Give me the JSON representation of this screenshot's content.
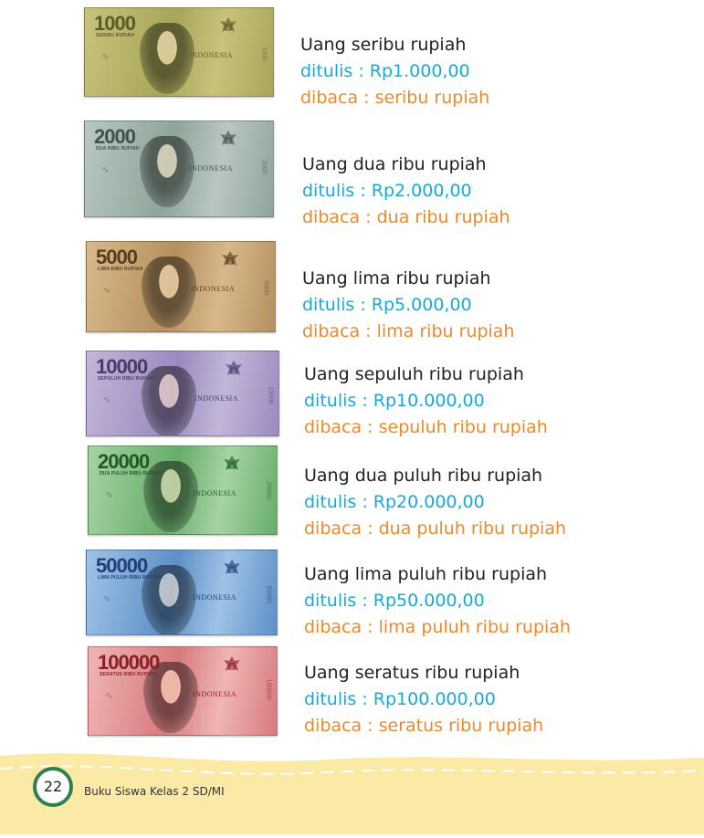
{
  "notes": [
    {
      "denom": "1000",
      "words": "SERIBU RUPIAH",
      "country": "INDONESIA",
      "title": "Uang seribu rupiah",
      "ditulis": "ditulis  : Rp1.000,00",
      "dibaca": "dibaca : seribu rupiah",
      "color_a": "#c8c27a",
      "color_b": "#a8a65a",
      "ink": "#5b5a2a"
    },
    {
      "denom": "2000",
      "words": "DUA RIBU RUPIAH",
      "country": "INDONESIA",
      "title": "Uang dua ribu rupiah",
      "ditulis": "ditulis  : Rp2.000,00",
      "dibaca": "dibaca : dua ribu rupiah",
      "color_a": "#b9c7c0",
      "color_b": "#8fa59a",
      "ink": "#3e5249"
    },
    {
      "denom": "5000",
      "words": "LIMA RIBU RUPIAH",
      "country": "INDONESIA",
      "title": "Uang lima ribu rupiah",
      "ditulis": "ditulis  : Rp5.000,00",
      "dibaca": "dibaca : lima ribu rupiah",
      "color_a": "#d8b98c",
      "color_b": "#b58f5e",
      "ink": "#5a3b1e"
    },
    {
      "denom": "10000",
      "words": "SEPULUH RIBU RUPIAH",
      "country": "INDONESIA",
      "title": "Uang sepuluh ribu rupiah",
      "ditulis": "ditulis  : Rp10.000,00",
      "dibaca": "dibaca : sepuluh ribu rupiah",
      "color_a": "#c2b6d8",
      "color_b": "#9c89bf",
      "ink": "#4a3a6a"
    },
    {
      "denom": "20000",
      "words": "DUA PULUH RIBU RUPIAH",
      "country": "INDONESIA",
      "title": "Uang dua puluh ribu rupiah",
      "ditulis": "ditulis  : Rp20.000,00",
      "dibaca": "dibaca : dua puluh ribu rupiah",
      "color_a": "#a6d3a4",
      "color_b": "#67ad6a",
      "ink": "#1f5a26"
    },
    {
      "denom": "50000",
      "words": "LIMA PULUH RIBU RUPIAH",
      "country": "INDONESIA",
      "title": "Uang lima puluh ribu rupiah",
      "ditulis": "ditulis  : Rp50.000,00",
      "dibaca": "dibaca : lima puluh ribu rupiah",
      "color_a": "#9fc3e6",
      "color_b": "#5d8fc7",
      "ink": "#1e3f78"
    },
    {
      "denom": "100000",
      "words": "SERATUS RIBU RUPIAH",
      "country": "INDONESIA",
      "title": "Uang seratus ribu rupiah",
      "ditulis": "ditulis  : Rp100.000,00",
      "dibaca": "dibaca : seratus ribu rupiah",
      "color_a": "#f0b5b5",
      "color_b": "#d77a7d",
      "ink": "#8a1f28"
    }
  ],
  "footer": {
    "page_number": "22",
    "book_title": "Buku Siswa Kelas 2 SD/MI",
    "band_color": "#fbe9a6",
    "ring_color": "#2f7f50"
  }
}
